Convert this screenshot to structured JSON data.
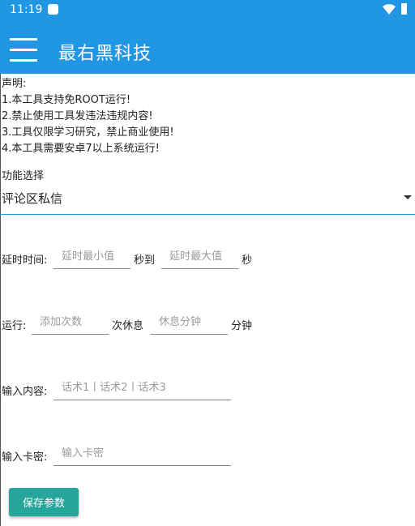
{
  "status_bar": {
    "time": "11:19"
  },
  "app_bar": {
    "title": "最右黑科技",
    "color": "#2196e3"
  },
  "notice": {
    "heading": "声明:",
    "lines": [
      "1.本工具支持免ROOT运行!",
      "2.禁止使用工具发违法违规内容!",
      "3.工具仅限学习研究，禁止商业使用!",
      "4.本工具需要安卓7以上系统运行!"
    ]
  },
  "function_select": {
    "label": "功能选择",
    "selected": "评论区私信"
  },
  "delay": {
    "label": "延时时间:",
    "min_placeholder": "延时最小值",
    "to_text": "秒到",
    "max_placeholder": "延时最大值",
    "unit": "秒"
  },
  "run": {
    "label": "运行:",
    "count_placeholder": "添加次数",
    "rest_text": "次休息",
    "rest_placeholder": "休息分钟",
    "unit": "分钟"
  },
  "content": {
    "label": "输入内容:",
    "placeholder": "话术1丨话术2丨话术3"
  },
  "card": {
    "label": "输入卡密:",
    "placeholder": "输入卡密"
  },
  "save_button": {
    "label": "保存参数",
    "color": "#26a69a"
  }
}
